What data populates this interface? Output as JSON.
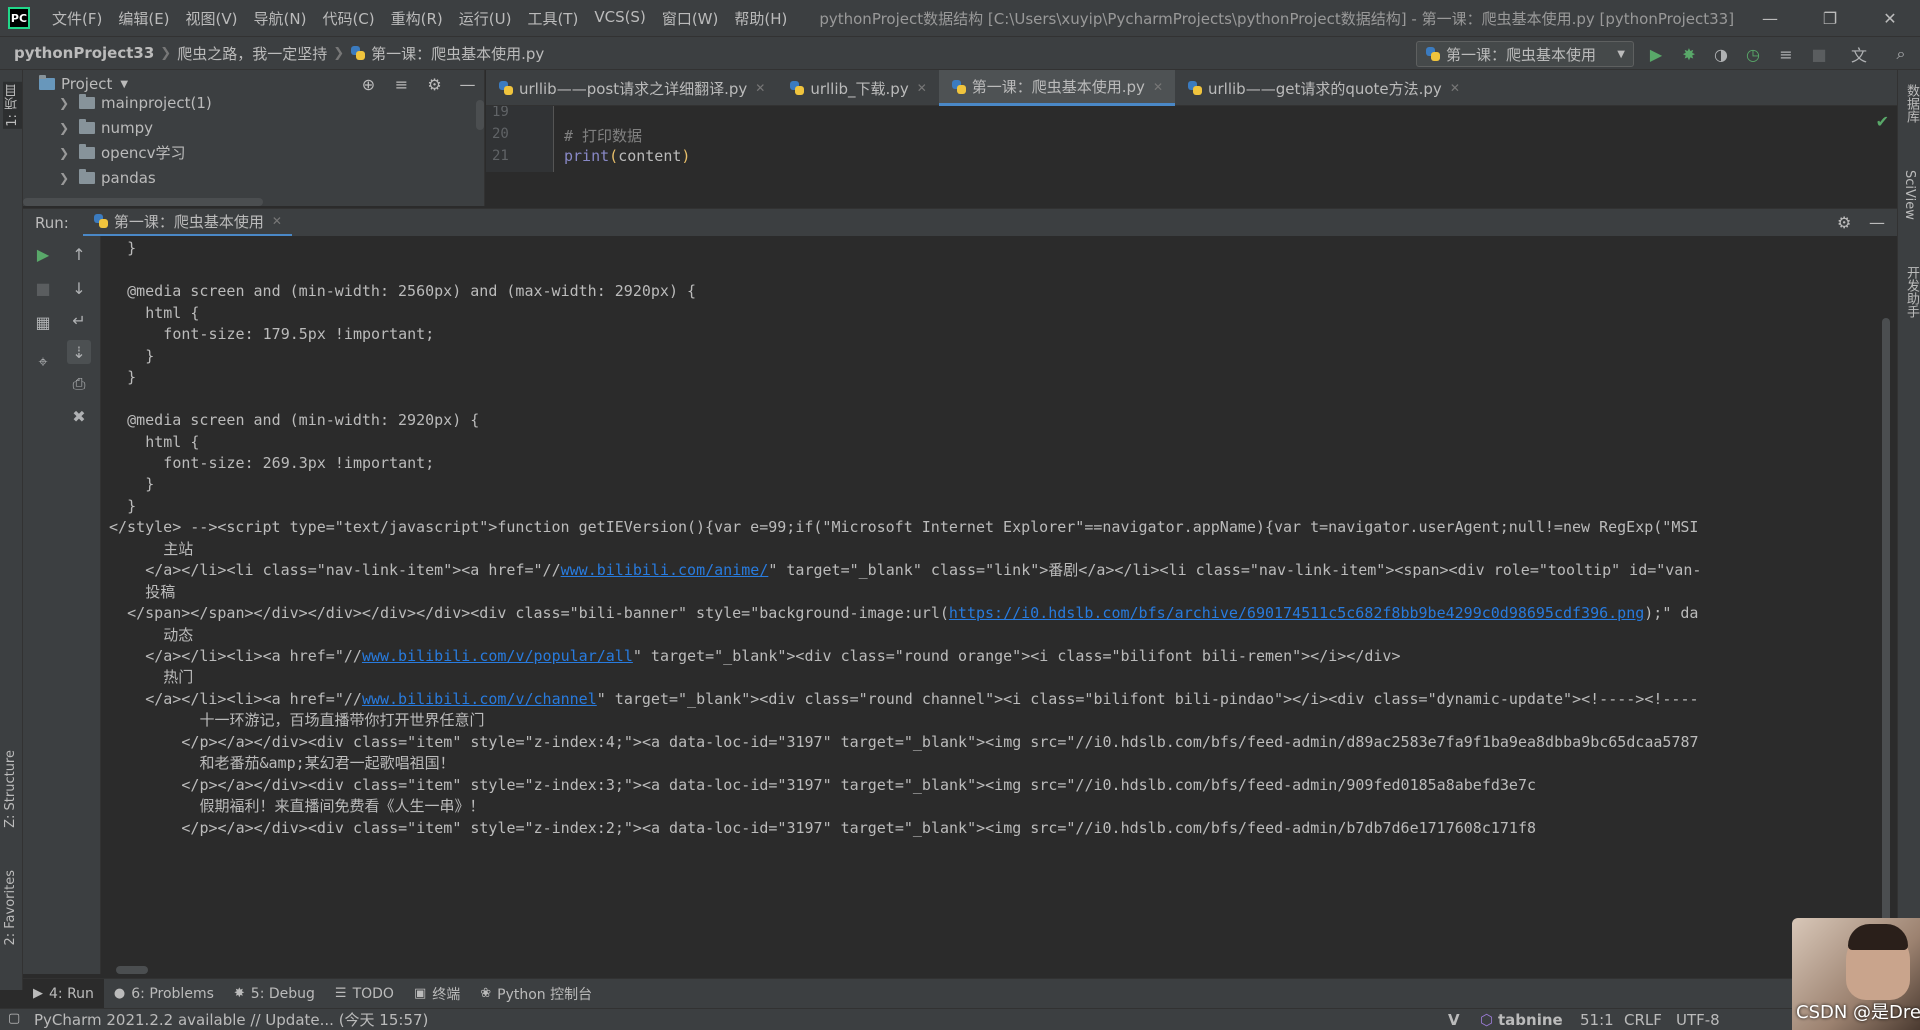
{
  "app": {
    "logo_text": "PC",
    "menu": [
      "文件(F)",
      "编辑(E)",
      "视图(V)",
      "导航(N)",
      "代码(C)",
      "重构(R)",
      "运行(U)",
      "工具(T)",
      "VCS(S)",
      "窗口(W)",
      "帮助(H)"
    ],
    "window_title": "pythonProject数据结构 [C:\\Users\\xuyip\\PycharmProjects\\pythonProject数据结构] - 第一课：爬虫基本使用.py [pythonProject33]"
  },
  "navbar": {
    "breadcrumbs": [
      "pythonProject33",
      "爬虫之路，我一定坚持",
      "第一课：爬虫基本使用.py"
    ],
    "run_config": "第一课：爬虫基本使用"
  },
  "project_panel": {
    "title": "Project",
    "items": [
      {
        "label": "mainproject(1)"
      },
      {
        "label": "numpy"
      },
      {
        "label": "opencv学习"
      },
      {
        "label": "pandas"
      }
    ]
  },
  "left_stripe": {
    "project_tab": "1: 项目",
    "structure_tab": "Z: Structure",
    "favorites_tab": "2: Favorites"
  },
  "right_stripe": {
    "database_tab": "数据库",
    "sciview_tab": "SciView",
    "assistant_tab": "开发助手"
  },
  "editor": {
    "tabs": [
      {
        "label": "urllib——post请求之详细翻译.py",
        "active": false
      },
      {
        "label": "urllib_下载.py",
        "active": false
      },
      {
        "label": "第一课：爬虫基本使用.py",
        "active": true
      },
      {
        "label": "urllib——get请求的quote方法.py",
        "active": false
      }
    ],
    "lines": [
      {
        "num": "19",
        "text": ""
      },
      {
        "num": "20",
        "text": "# 打印数据"
      },
      {
        "num": "21",
        "fn": "print",
        "arg": "content"
      }
    ]
  },
  "run": {
    "label": "Run:",
    "tab_label": "第一课：爬虫基本使用",
    "console_lines": [
      {
        "indent": 2,
        "text": "}"
      },
      {
        "indent": 2,
        "text": "}"
      },
      {
        "indent": 0,
        "text": ""
      },
      {
        "indent": 2,
        "text": "@media screen and (min-width: 2560px) and (max-width: 2920px) {"
      },
      {
        "indent": 4,
        "text": "html {"
      },
      {
        "indent": 6,
        "text": "font-size: 179.5px !important;"
      },
      {
        "indent": 4,
        "text": "}"
      },
      {
        "indent": 2,
        "text": "}"
      },
      {
        "indent": 0,
        "text": ""
      },
      {
        "indent": 2,
        "text": "@media screen and (min-width: 2920px) {"
      },
      {
        "indent": 4,
        "text": "html {"
      },
      {
        "indent": 6,
        "text": "font-size: 269.3px !important;"
      },
      {
        "indent": 4,
        "text": "}"
      },
      {
        "indent": 2,
        "text": "}"
      },
      {
        "indent": 0,
        "text": "</style> --><script type=\"text/javascript\">function getIEVersion(){var e=99;if(\"Microsoft Internet Explorer\"==navigator.appName){var t=navigator.userAgent;null!=new RegExp(\"MSI"
      },
      {
        "indent": 6,
        "text": "主站"
      },
      {
        "indent": 4,
        "pre": "</a></li><li class=\"nav-link-item\"><a href=\"//",
        "link": "www.bilibili.com/anime/",
        "post": "\" target=\"_blank\" class=\"link\">番剧</a></li><li class=\"nav-link-item\"><span><div role=\"tooltip\" id=\"van-"
      },
      {
        "indent": 4,
        "text": "投稿"
      },
      {
        "indent": 2,
        "pre": "</span></span></div></div></div></div><div class=\"bili-banner\" style=\"background-image:url(",
        "link": "https://i0.hdslb.com/bfs/archive/690174511c5c682f8bb9be4299c0d98695cdf396.png",
        "post": ");\" da"
      },
      {
        "indent": 6,
        "text": "动态"
      },
      {
        "indent": 4,
        "pre": "</a></li><li><a href=\"//",
        "link": "www.bilibili.com/v/popular/all",
        "post": "\" target=\"_blank\"><div class=\"round orange\"><i class=\"bilifont bili-remen\"></i></div>"
      },
      {
        "indent": 6,
        "text": "热门"
      },
      {
        "indent": 4,
        "pre": "</a></li><li><a href=\"//",
        "link": "www.bilibili.com/v/channel",
        "post": "\" target=\"_blank\"><div class=\"round channel\"><i class=\"bilifont bili-pindao\"></i><div class=\"dynamic-update\"><!----><!----"
      },
      {
        "indent": 10,
        "text": "十一环游记，百场直播带你打开世界任意门"
      },
      {
        "indent": 8,
        "text": "</p></a></div><div class=\"item\" style=\"z-index:4;\"><a data-loc-id=\"3197\" target=\"_blank\"><img src=\"//i0.hdslb.com/bfs/feed-admin/d89ac2583e7fa9f1ba9ea8dbba9bc65dcaa5787"
      },
      {
        "indent": 10,
        "text": "和老番茄&amp;某幻君一起歌唱祖国！"
      },
      {
        "indent": 8,
        "text": "</p></a></div><div class=\"item\" style=\"z-index:3;\"><a data-loc-id=\"3197\" target=\"_blank\"><img src=\"//i0.hdslb.com/bfs/feed-admin/909fed0185a8abefd3e7c"
      },
      {
        "indent": 10,
        "text": "假期福利！来直播间免费看《人生一串》！"
      },
      {
        "indent": 8,
        "text": "</p></a></div><div class=\"item\" style=\"z-index:2;\"><a data-loc-id=\"3197\" target=\"_blank\"><img src=\"//i0.hdslb.com/bfs/feed-admin/b7db7d6e1717608c171f8"
      }
    ]
  },
  "bottom_tabs": [
    {
      "label": "4: Run",
      "icon": "run-icon",
      "active": true
    },
    {
      "label": "6: Problems",
      "icon": "problems-icon",
      "active": false
    },
    {
      "label": "5: Debug",
      "icon": "debug-icon",
      "active": false
    },
    {
      "label": "TODO",
      "icon": "todo-icon",
      "active": false
    },
    {
      "label": "终端",
      "icon": "terminal-icon",
      "active": false
    },
    {
      "label": "Python 控制台",
      "icon": "python-console-icon",
      "active": false
    }
  ],
  "statusbar": {
    "message": "PyCharm 2021.2.2 available // Update... (今天 15:57)",
    "tabnine": "tabnine",
    "position": "51:1",
    "line_sep": "CRLF",
    "encoding": "UTF-8"
  },
  "watermark": {
    "text": "CSDN @是Dream呀"
  },
  "colors": {
    "accent": "#4a88c7",
    "run_green": "#59a869",
    "link": "#287bde",
    "background": "#2b2b2b",
    "panel": "#3c3f41"
  }
}
